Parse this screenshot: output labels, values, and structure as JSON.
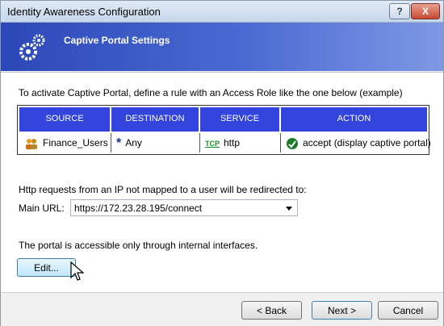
{
  "window": {
    "title": "Identity Awareness Configuration",
    "help_label": "?",
    "close_label": "X"
  },
  "header": {
    "title": "Captive Portal Settings"
  },
  "intro_text": "To activate Captive Portal, define a rule with an Access Role like the one below (example)",
  "table": {
    "columns": [
      "SOURCE",
      "DESTINATION",
      "SERVICE",
      "ACTION"
    ],
    "row": {
      "source": "Finance_Users",
      "destination": "Any",
      "service_tag": "TCP",
      "service": "http",
      "action": "accept (display captive portal)"
    }
  },
  "redirect_text": "Http requests from an IP not mapped to a user will be redirected to:",
  "main_url": {
    "label": "Main URL:",
    "value": "https://172.23.28.195/connect"
  },
  "portal_note": "The portal is accessible only through internal interfaces.",
  "buttons": {
    "edit": "Edit...",
    "back": "< Back",
    "next": "Next >",
    "cancel": "Cancel"
  },
  "colors": {
    "table_header": "#3344dd",
    "banner": "#2c48b8",
    "accept_green": "#1a7a2a"
  }
}
